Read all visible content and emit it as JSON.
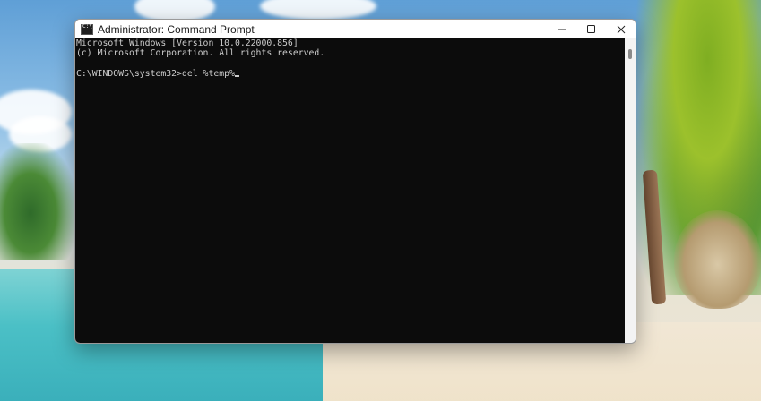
{
  "window": {
    "title": "Administrator: Command Prompt",
    "controls": {
      "minimize": "minimize",
      "maximize": "maximize",
      "close": "close"
    }
  },
  "console": {
    "lines": [
      "Microsoft Windows [Version 10.0.22000.856]",
      "(c) Microsoft Corporation. All rights reserved.",
      "",
      "C:\\WINDOWS\\system32>del %temp%"
    ]
  },
  "icons": {
    "app": "command-prompt-icon",
    "minimize": "minimize-icon",
    "maximize": "maximize-icon",
    "close": "close-icon"
  }
}
